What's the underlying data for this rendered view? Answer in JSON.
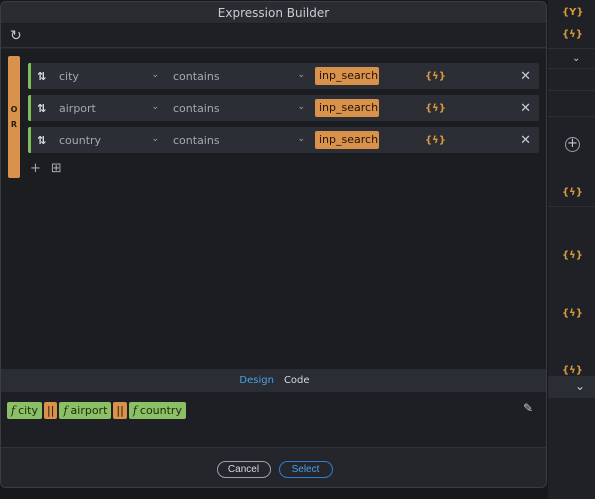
{
  "dialog": {
    "title": "Expression Builder"
  },
  "conditions": [
    {
      "field": "city",
      "operator": "contains",
      "value": "inp_search.."
    },
    {
      "field": "airport",
      "operator": "contains",
      "value": "inp_search.."
    },
    {
      "field": "country",
      "operator": "contains",
      "value": "inp_search.."
    }
  ],
  "group": {
    "operator_letters": [
      "O",
      "R"
    ]
  },
  "icons": {
    "refresh": "↻",
    "sort": "⇅",
    "chevron": "⌄",
    "bolt": "{ϟ}",
    "close": "✕",
    "add": "+",
    "add_group": "⊞",
    "wand": "✎",
    "plus_circle": "+",
    "bg_filter": "{Y}",
    "bg_bolt": "{ϟ}"
  },
  "tabs": {
    "design": "Design",
    "code": "Code"
  },
  "expression": {
    "fn_symbol": "f",
    "or_symbol": "||",
    "items": [
      "city",
      "airport",
      "country"
    ]
  },
  "footer": {
    "cancel": "Cancel",
    "select": "Select"
  },
  "colors": {
    "accent_blue": "#4aa0e6",
    "orange": "#d9924b",
    "green": "#8cc065"
  }
}
